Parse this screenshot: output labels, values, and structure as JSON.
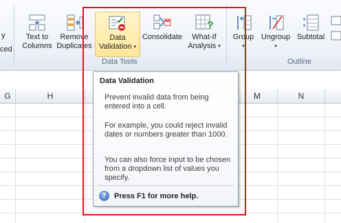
{
  "ribbon": {
    "partial_left_top": "y",
    "partial_left_bottom": "ced",
    "text_to_columns": {
      "line1": "Text to",
      "line2": "Columns"
    },
    "remove_duplicates": {
      "line1": "Remove",
      "line2": "Duplicates"
    },
    "data_validation": {
      "line1": "Data",
      "line2": "Validation"
    },
    "consolidate": {
      "line1": "Consolidate"
    },
    "what_if": {
      "line1": "What-If",
      "line2": "Analysis"
    },
    "group": {
      "line1": "Group"
    },
    "ungroup": {
      "line1": "Ungroup"
    },
    "subtotal": {
      "line1": "Subtotal"
    },
    "group_label_data_tools": "Data Tools",
    "group_label_outline": "Outline",
    "caret": "▾"
  },
  "columns": [
    "G",
    "H",
    "M",
    "N"
  ],
  "tooltip": {
    "title": "Data Validation",
    "p1": "Prevent invalid data from being entered into a cell.",
    "p2": "For example, you could reject invalid dates or numbers greater than 1000.",
    "p3": "You can also force input to be chosen from a dropdown list of values you specify.",
    "help_icon": "?",
    "help": "Press F1 for more help."
  },
  "colors": {
    "annotation_red": "#e0101c",
    "ribbon_bg": "#eef2f8",
    "active_button": "#ffe59a"
  }
}
